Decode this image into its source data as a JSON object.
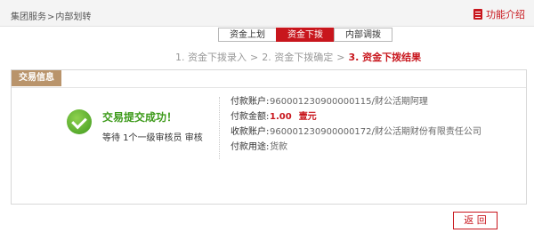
{
  "breadcrumb": {
    "items": [
      "集团服务",
      "内部划转"
    ],
    "separator": ">"
  },
  "header": {
    "function_intro": "功能介绍"
  },
  "tabs": [
    {
      "label": "资金上划",
      "active": false
    },
    {
      "label": "资金下拨",
      "active": true
    },
    {
      "label": "内部调拨",
      "active": false
    }
  ],
  "steps": {
    "items": [
      "1. 资金下拨录入",
      "2. 资金下拨确定",
      "3. 资金下拨结果"
    ],
    "current_index": 2,
    "arrow": ">"
  },
  "panel": {
    "tag": "交易信息",
    "success_title": "交易提交成功！",
    "success_sub": "等待 1个一级审核员 审核",
    "details": [
      {
        "label": "付款账户:",
        "value": "960001230900000115/财公活期阿理"
      },
      {
        "label": "付款金额:",
        "value": "1.00",
        "value_cn": "壹元",
        "highlight": true
      },
      {
        "label": "收款账户:",
        "value": "960001230900000172/财公活期财份有限责任公司"
      },
      {
        "label": "付款用途:",
        "value": "货款"
      }
    ]
  },
  "back_button": "返 回",
  "colors": {
    "accent": "#c8161d",
    "tag_bg": "#b9946b",
    "success": "#3d9a1a"
  }
}
